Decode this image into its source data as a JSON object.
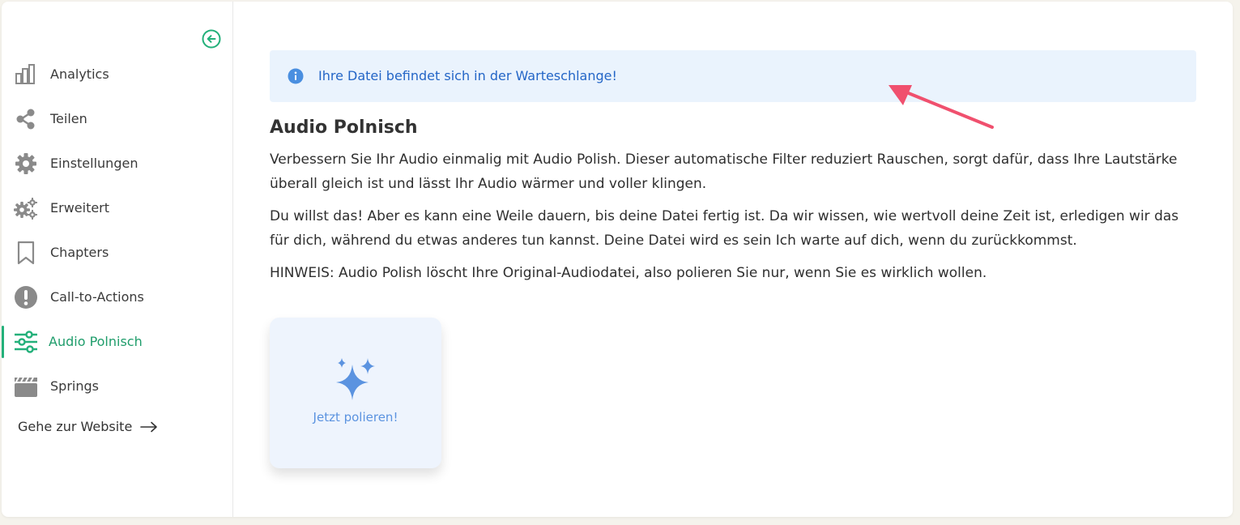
{
  "sidebar": {
    "items": [
      {
        "label": "Analytics",
        "icon": "bar-chart-icon"
      },
      {
        "label": "Teilen",
        "icon": "share-icon"
      },
      {
        "label": "Einstellungen",
        "icon": "gear-icon"
      },
      {
        "label": "Erweitert",
        "icon": "gears-icon"
      },
      {
        "label": "Chapters",
        "icon": "bookmark-icon"
      },
      {
        "label": "Call-to-Actions",
        "icon": "exclamation-icon"
      },
      {
        "label": "Audio Polnisch",
        "icon": "sliders-icon",
        "active": true
      },
      {
        "label": "Springs",
        "icon": "clapperboard-icon"
      }
    ],
    "website_link": "Gehe zur Website"
  },
  "alert": {
    "text": "Ihre Datei befindet sich in der Warteschlange!"
  },
  "main": {
    "title": "Audio Polnisch",
    "paragraphs": [
      "Verbessern Sie Ihr Audio einmalig mit Audio Polish. Dieser automatische Filter reduziert Rauschen, sorgt dafür, dass Ihre Lautstärke überall gleich ist und lässt Ihr Audio wärmer und voller klingen.",
      "Du willst das! Aber es kann eine Weile dauern, bis deine Datei fertig ist. Da wir wissen, wie wertvoll deine Zeit ist, erledigen wir das für dich, während du etwas anderes tun kannst. Deine Datei wird es sein Ich warte auf dich, wenn du zurückkommst.",
      "HINWEIS: Audio Polish löscht Ihre Original-Audiodatei, also polieren Sie nur, wenn Sie es wirklich wollen."
    ],
    "polish_button": "Jetzt polieren!"
  },
  "colors": {
    "accent": "#23b07a",
    "alert_bg": "#eaf3fd",
    "alert_text": "#2466c7",
    "annotation_arrow": "#f0506e",
    "sparkle": "#5b93e0"
  }
}
